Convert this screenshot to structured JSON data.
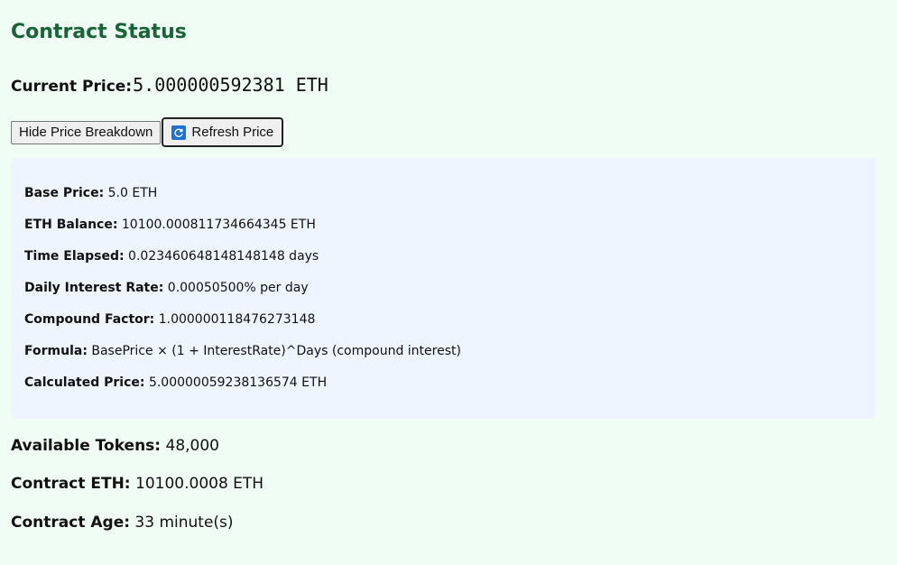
{
  "heading": "Contract Status",
  "current_price": {
    "label": "Current Price:",
    "value": "5.000000592381 ETH"
  },
  "buttons": {
    "hide_breakdown": "Hide Price Breakdown",
    "refresh": "Refresh Price",
    "refresh_icon": "refresh-icon"
  },
  "breakdown": [
    {
      "label": "Base Price:",
      "value": "5.0 ETH"
    },
    {
      "label": "ETH Balance:",
      "value": "10100.000811734664345 ETH"
    },
    {
      "label": "Time Elapsed:",
      "value": "0.023460648148148148 days"
    },
    {
      "label": "Daily Interest Rate:",
      "value": "0.00050500% per day"
    },
    {
      "label": "Compound Factor:",
      "value": "1.000000118476273148"
    },
    {
      "label": "Formula:",
      "value": "BasePrice × (1 + InterestRate)^Days (compound interest)"
    },
    {
      "label": "Calculated Price:",
      "value": "5.00000059238136574 ETH"
    }
  ],
  "stats": {
    "available_tokens": {
      "label": "Available Tokens:",
      "value": "48,000"
    },
    "contract_eth": {
      "label": "Contract ETH:",
      "value": "10100.0008 ETH"
    },
    "contract_age": {
      "label": "Contract Age:",
      "value": "33 minute(s)"
    }
  },
  "colors": {
    "page_bg": "#f0fdf4",
    "heading": "#166534",
    "breakdown_bg": "#eef5ff",
    "refresh_icon_bg": "#1d6fd6"
  }
}
